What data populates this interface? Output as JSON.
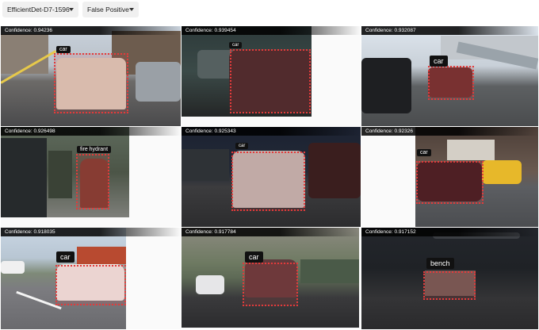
{
  "toolbar": {
    "model_select": "EfficientDet-D7-1596",
    "filter_select": "False Positive"
  },
  "results": [
    {
      "confidence": "Confidence: 0.94236",
      "label": "car"
    },
    {
      "confidence": "Confidence: 0.939454",
      "label": "car"
    },
    {
      "confidence": "Confidence: 0.932087",
      "label": "car"
    },
    {
      "confidence": "Confidence: 0.926498",
      "label": "fire hydrant"
    },
    {
      "confidence": "Confidence: 0.925343",
      "label": "car"
    },
    {
      "confidence": "Confidence: 0.92326",
      "label": "car"
    },
    {
      "confidence": "Confidence: 0.918035",
      "label": "car"
    },
    {
      "confidence": "Confidence: 0.917784",
      "label": "car"
    },
    {
      "confidence": "Confidence: 0.917152",
      "label": "bench"
    }
  ],
  "colors": {
    "bbox": "#e23b3b",
    "label_bg": "#111111",
    "dropdown_bg": "#f0f0f0"
  }
}
